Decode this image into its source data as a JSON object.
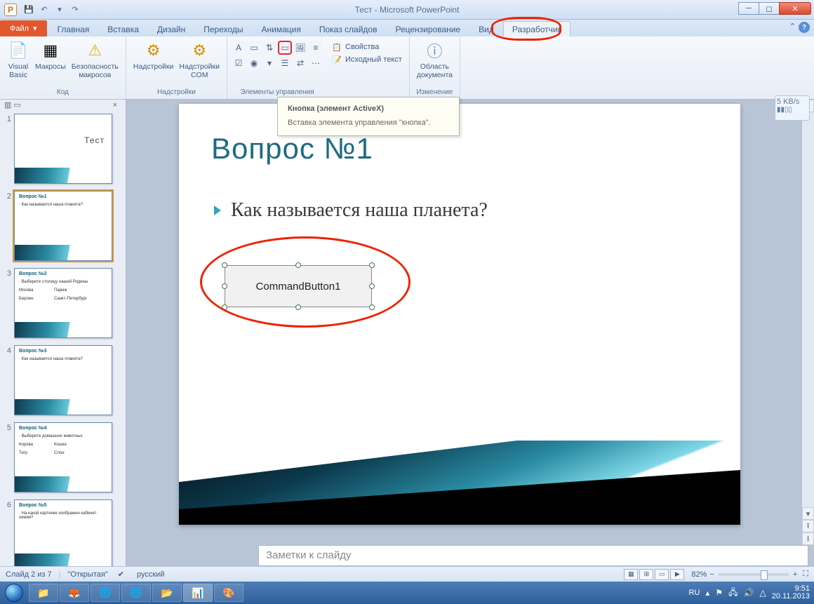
{
  "window": {
    "title": "Тест - Microsoft PowerPoint",
    "app_letter": "P"
  },
  "qat": [
    "save-icon",
    "undo-icon",
    "redo-icon"
  ],
  "tabs": {
    "file": "Файл",
    "items": [
      {
        "id": "home",
        "label": "Главная"
      },
      {
        "id": "insert",
        "label": "Вставка"
      },
      {
        "id": "design",
        "label": "Дизайн"
      },
      {
        "id": "transitions",
        "label": "Переходы"
      },
      {
        "id": "animation",
        "label": "Анимация"
      },
      {
        "id": "slideshow",
        "label": "Показ слайдов"
      },
      {
        "id": "review",
        "label": "Рецензирование"
      },
      {
        "id": "view",
        "label": "Вид"
      },
      {
        "id": "developer",
        "label": "Разработчик"
      }
    ],
    "active": "developer"
  },
  "ribbon": {
    "groups": {
      "code": {
        "label": "Код",
        "buttons": [
          {
            "id": "visual-basic",
            "label": "Visual\nBasic"
          },
          {
            "id": "macros",
            "label": "Макросы"
          },
          {
            "id": "macro-security",
            "label": "Безопасность\nмакросов"
          }
        ]
      },
      "addins": {
        "label": "Надстройки",
        "buttons": [
          {
            "id": "addins",
            "label": "Надстройки"
          },
          {
            "id": "com-addins",
            "label": "Надстройки\nCOM"
          }
        ]
      },
      "controls": {
        "label": "Элементы управления",
        "side": [
          {
            "id": "properties",
            "label": "Свойства"
          },
          {
            "id": "view-code",
            "label": "Исходный текст"
          }
        ]
      },
      "modify": {
        "label": "Изменение",
        "buttons": [
          {
            "id": "document-panel",
            "label": "Область\nдокумента"
          }
        ]
      }
    }
  },
  "tooltip": {
    "title": "Кнопка (элемент ActiveX)",
    "body": "Вставка элемента управления \"кнопка\"."
  },
  "thumbnails": [
    {
      "n": 1,
      "title": "Тест",
      "sub": ""
    },
    {
      "n": 2,
      "title": "Вопрос №1",
      "sub": "Как называется наша планета?",
      "selected": true
    },
    {
      "n": 3,
      "title": "Вопрос №2",
      "sub": "Выберите столицу нашей Родины",
      "opts": [
        "Москва",
        "Париж",
        "Берлин",
        "Санкт-Петербург"
      ]
    },
    {
      "n": 4,
      "title": "Вопрос №3",
      "sub": "Как называется наша планета?"
    },
    {
      "n": 5,
      "title": "Вопрос №4",
      "sub": "Выберите домашних животных",
      "opts": [
        "Корова",
        "Кошка",
        "Тигр",
        "Слон"
      ]
    },
    {
      "n": 6,
      "title": "Вопрос №5",
      "sub": "На какой картинке изображен кабинет химии?"
    }
  ],
  "slide": {
    "title": "Вопрос №1",
    "bullet": "Как называется наша планета?",
    "control_label": "CommandButton1"
  },
  "notes_placeholder": "Заметки к слайду",
  "status": {
    "slide_pos": "Слайд 2 из 7",
    "theme": "\"Открытая\"",
    "language": "русский",
    "zoom": "82%"
  },
  "net_widget": {
    "rate": "5 KB/s"
  },
  "taskbar": {
    "lang": "RU",
    "time": "9:51",
    "date": "20.11.2013"
  }
}
